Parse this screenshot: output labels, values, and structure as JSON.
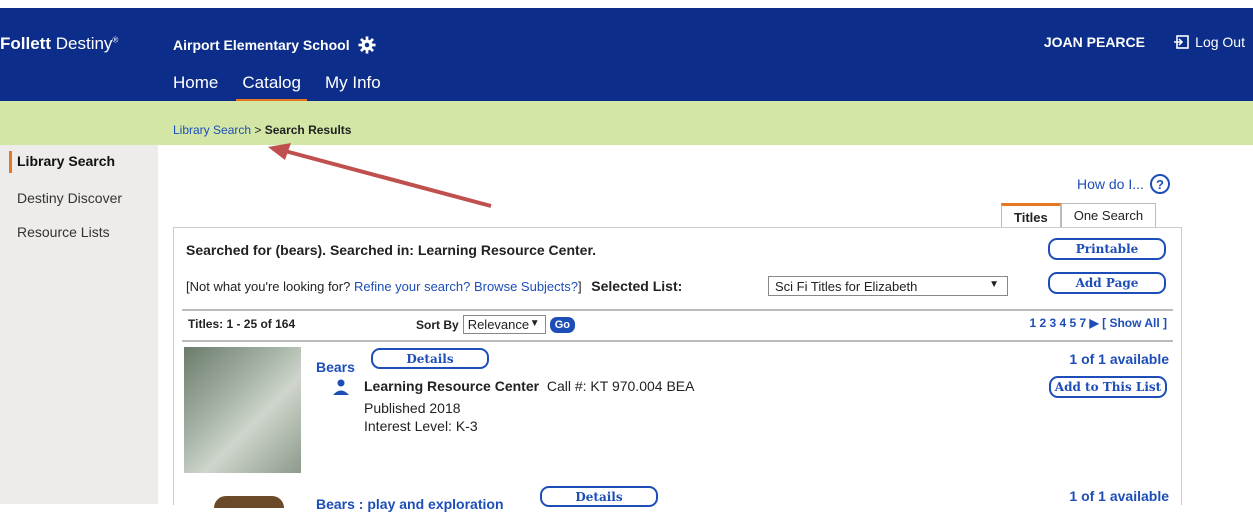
{
  "header": {
    "brand_bold": "Follett",
    "brand_thin": "Destiny",
    "brand_mark": "®",
    "school": "Airport Elementary School",
    "user": "JOAN PEARCE",
    "logout": "Log Out",
    "nav": [
      "Home",
      "Catalog",
      "My Info"
    ],
    "colors": {
      "header_bg": "#0c2d8a",
      "accent": "#e87722",
      "breadcrumb_bg": "#d3e6a5"
    }
  },
  "breadcrumb": {
    "link": "Library Search",
    "sep": " > ",
    "current": "Search Results"
  },
  "sidebar": {
    "items": [
      "Library Search",
      "Destiny Discover",
      "Resource Lists"
    ]
  },
  "help": {
    "label": "How do I...",
    "icon": "?"
  },
  "tabs": [
    "Titles",
    "One Search"
  ],
  "search": {
    "summary": "Searched for (bears). Searched in: Learning Resource Center.",
    "refine_prefix": "[Not what you're looking for?",
    "refine_link": "Refine your search?",
    "browse_link": "Browse Subjects?",
    "refine_suffix": "]",
    "selected_list_label": "Selected List:",
    "selected_list_value": "Sci Fi Titles for Elizabeth",
    "printable": "Printable",
    "add_page": "Add Page"
  },
  "results_bar": {
    "count": "Titles: 1 - 25 of 164",
    "sort_label": "Sort By",
    "sort_value": "Relevance",
    "go": "Go",
    "pages": "1 2 3 4 5 7",
    "show_all": "[ Show All ]"
  },
  "results": [
    {
      "title": "Bears",
      "details": "Details",
      "location": "Learning Resource Center",
      "call": "Call #: KT 970.004 BEA",
      "published": "Published 2018",
      "interest": "Interest Level: K-3",
      "availability": "1 of 1 available",
      "add": "Add to This List"
    },
    {
      "title": "Bears : play and exploration",
      "details": "Details",
      "availability": "1 of 1 available"
    }
  ]
}
